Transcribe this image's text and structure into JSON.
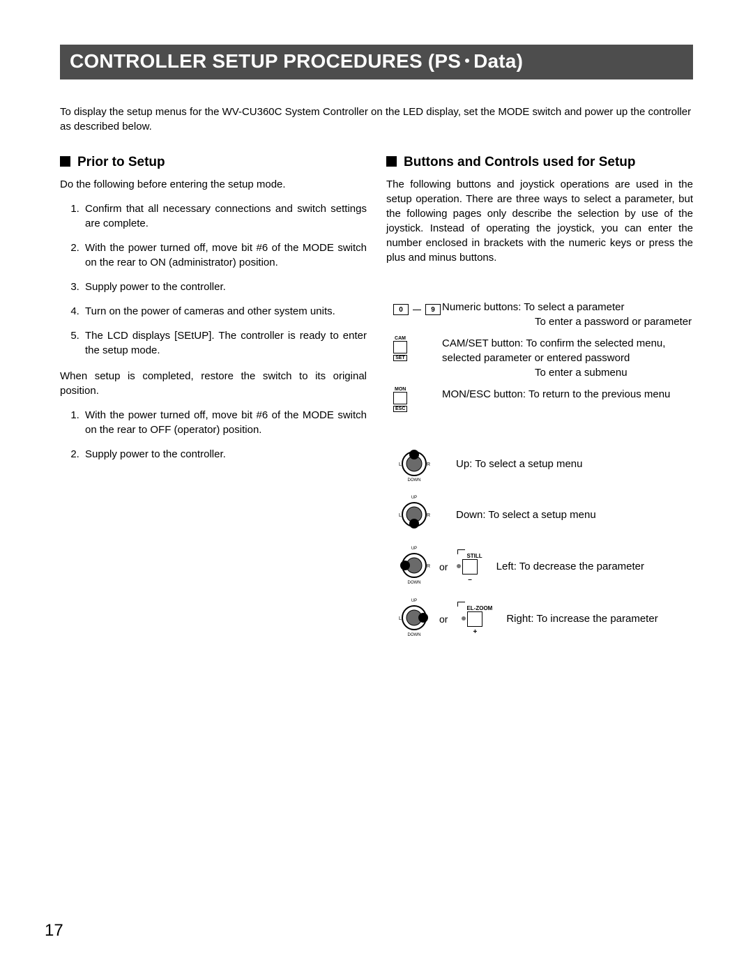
{
  "title_a": "CONTROLLER SETUP PROCEDURES (PS",
  "title_b": "Data)",
  "intro": "To display the setup menus for the WV-CU360C System Controller on the LED display, set the MODE switch and power up the controller as described below.",
  "left": {
    "heading": "Prior to Setup",
    "lead": "Do the following before entering the setup mode.",
    "steps1": [
      "Confirm that all necessary connections and switch settings are complete.",
      "With the power turned off, move bit #6 of the MODE switch on the rear to ON (administrator) position.",
      "Supply power to the controller.",
      "Turn on the power of cameras and other system units.",
      "The LCD displays [SEtUP]. The controller is ready to enter the setup mode."
    ],
    "mid": "When setup is completed, restore the switch to its original position.",
    "steps2": [
      "With the power turned off, move bit #6 of the MODE switch on the rear to OFF (operator) position.",
      "Supply power to the controller."
    ]
  },
  "right": {
    "heading": "Buttons and Controls used for Setup",
    "lead": "The following buttons and joystick operations are used in the setup operation.  There are three ways to select a parameter, but the following pages only describe the selection by use of the joystick.  Instead of operating the joystick, you can enter the number enclosed in brackets with the numeric keys or press the plus and minus buttons.",
    "numeric_a": "Numeric buttons: To select a parameter",
    "numeric_b": "To enter a password or parameter",
    "camset_a": "CAM/SET button: To confirm the selected menu, selected parameter or entered password",
    "camset_b": "To enter a submenu",
    "monesc": "MON/ESC button: To return to the previous menu",
    "joy_up": "Up: To select a setup menu",
    "joy_down": "Down: To select a setup menu",
    "joy_left": "Left: To decrease the parameter",
    "joy_right": "Right: To increase the parameter",
    "or": "or",
    "labels": {
      "key0": "0",
      "key9": "9",
      "cam": "CAM",
      "set": "SET",
      "mon": "MON",
      "esc": "ESC",
      "still": "STILL",
      "elzoom": "EL-ZOOM",
      "minus": "–",
      "plus": "+",
      "up": "UP",
      "down": "DOWN",
      "l": "L",
      "r": "R"
    }
  },
  "page_number": "17"
}
